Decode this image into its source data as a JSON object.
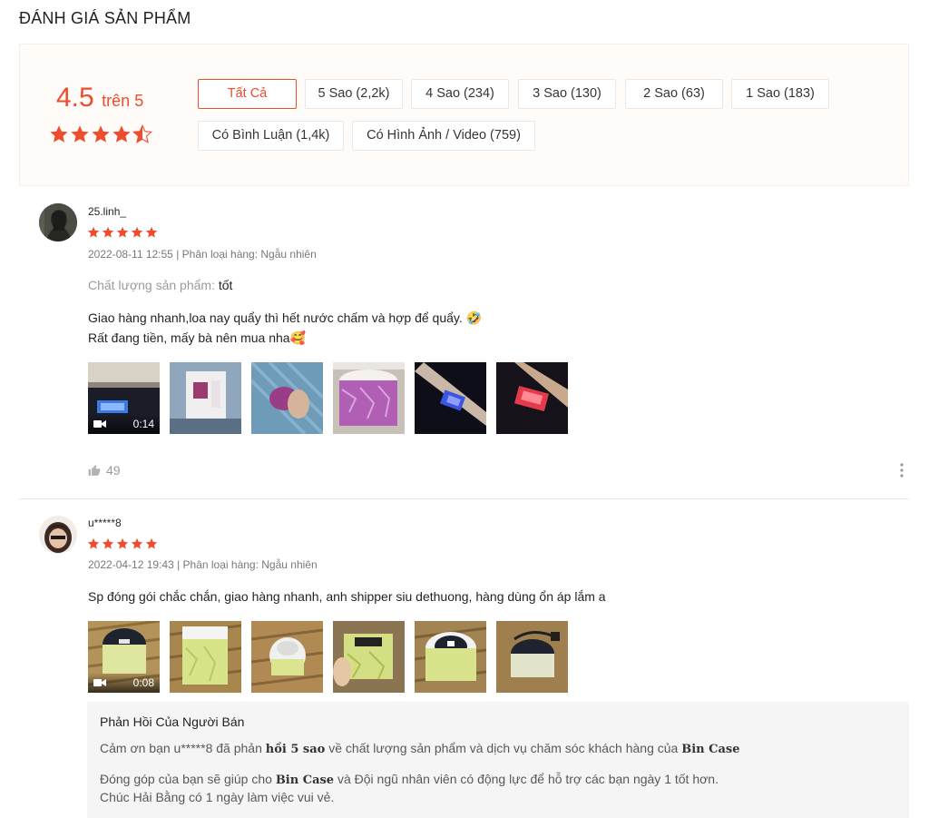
{
  "page": {
    "title": "ĐÁNH GIÁ SẢN PHẨM"
  },
  "overview": {
    "score": "4.5",
    "score_suffix": "trên 5",
    "rating_stars": 4.5,
    "filters": [
      "Tất Cả",
      "5 Sao (2,2k)",
      "4 Sao (234)",
      "3 Sao (130)",
      "2 Sao (63)",
      "1 Sao (183)",
      "Có Bình Luận (1,4k)",
      "Có Hình Ảnh / Video (759)"
    ],
    "active_filter": "Tất Cả"
  },
  "colors": {
    "accent": "#ee4d2d",
    "star": "#ee4d2d"
  },
  "reviews": [
    {
      "username": "25.linh_",
      "stars": 5,
      "meta": "2022-08-11 12:55 | Phân loại hàng: Ngẫu nhiên",
      "quality_label": "Chất lượng sản phẩm:",
      "quality_value": "tốt",
      "line1": "Giao hàng nhanh,loa nay quẩy thì hết nước chấm và hợp để quẩy. 🤣",
      "line2": "Rất đang tiền, mấy bà nên mua nha🥰",
      "video_duration": "0:14",
      "likes": "49"
    },
    {
      "username": "u*****8",
      "stars": 5,
      "meta": "2022-04-12 19:43 | Phân loại hàng: Ngẫu nhiên",
      "line1": "Sp đóng gói chắc chắn, giao hàng nhanh, anh shipper siu dethuong, hàng dùng ổn áp lắm a",
      "video_duration": "0:08"
    }
  ],
  "seller_reply": {
    "title": "Phản Hồi Của Người Bán",
    "p1_a": "Cảm ơn bạn u*****8 đã phản ",
    "p1_b1": "hồi 5 sao",
    "p1_c": " về chất lượng sản phẩm và dịch vụ chăm sóc khách hàng của ",
    "p1_b2": "Bin Case",
    "p2_a": "Đóng góp của bạn  sẽ giúp cho ",
    "p2_b": "Bin Case",
    "p2_c": " và Đội ngũ nhân viên có động lực để hỗ trợ các bạn ngày 1 tốt hơn.",
    "p3": "Chúc Hải Bằng có 1 ngày làm việc vui vẻ."
  },
  "icons": [
    "star-icon",
    "video-camera-icon",
    "thumb-up-icon",
    "more-vertical-icon"
  ]
}
